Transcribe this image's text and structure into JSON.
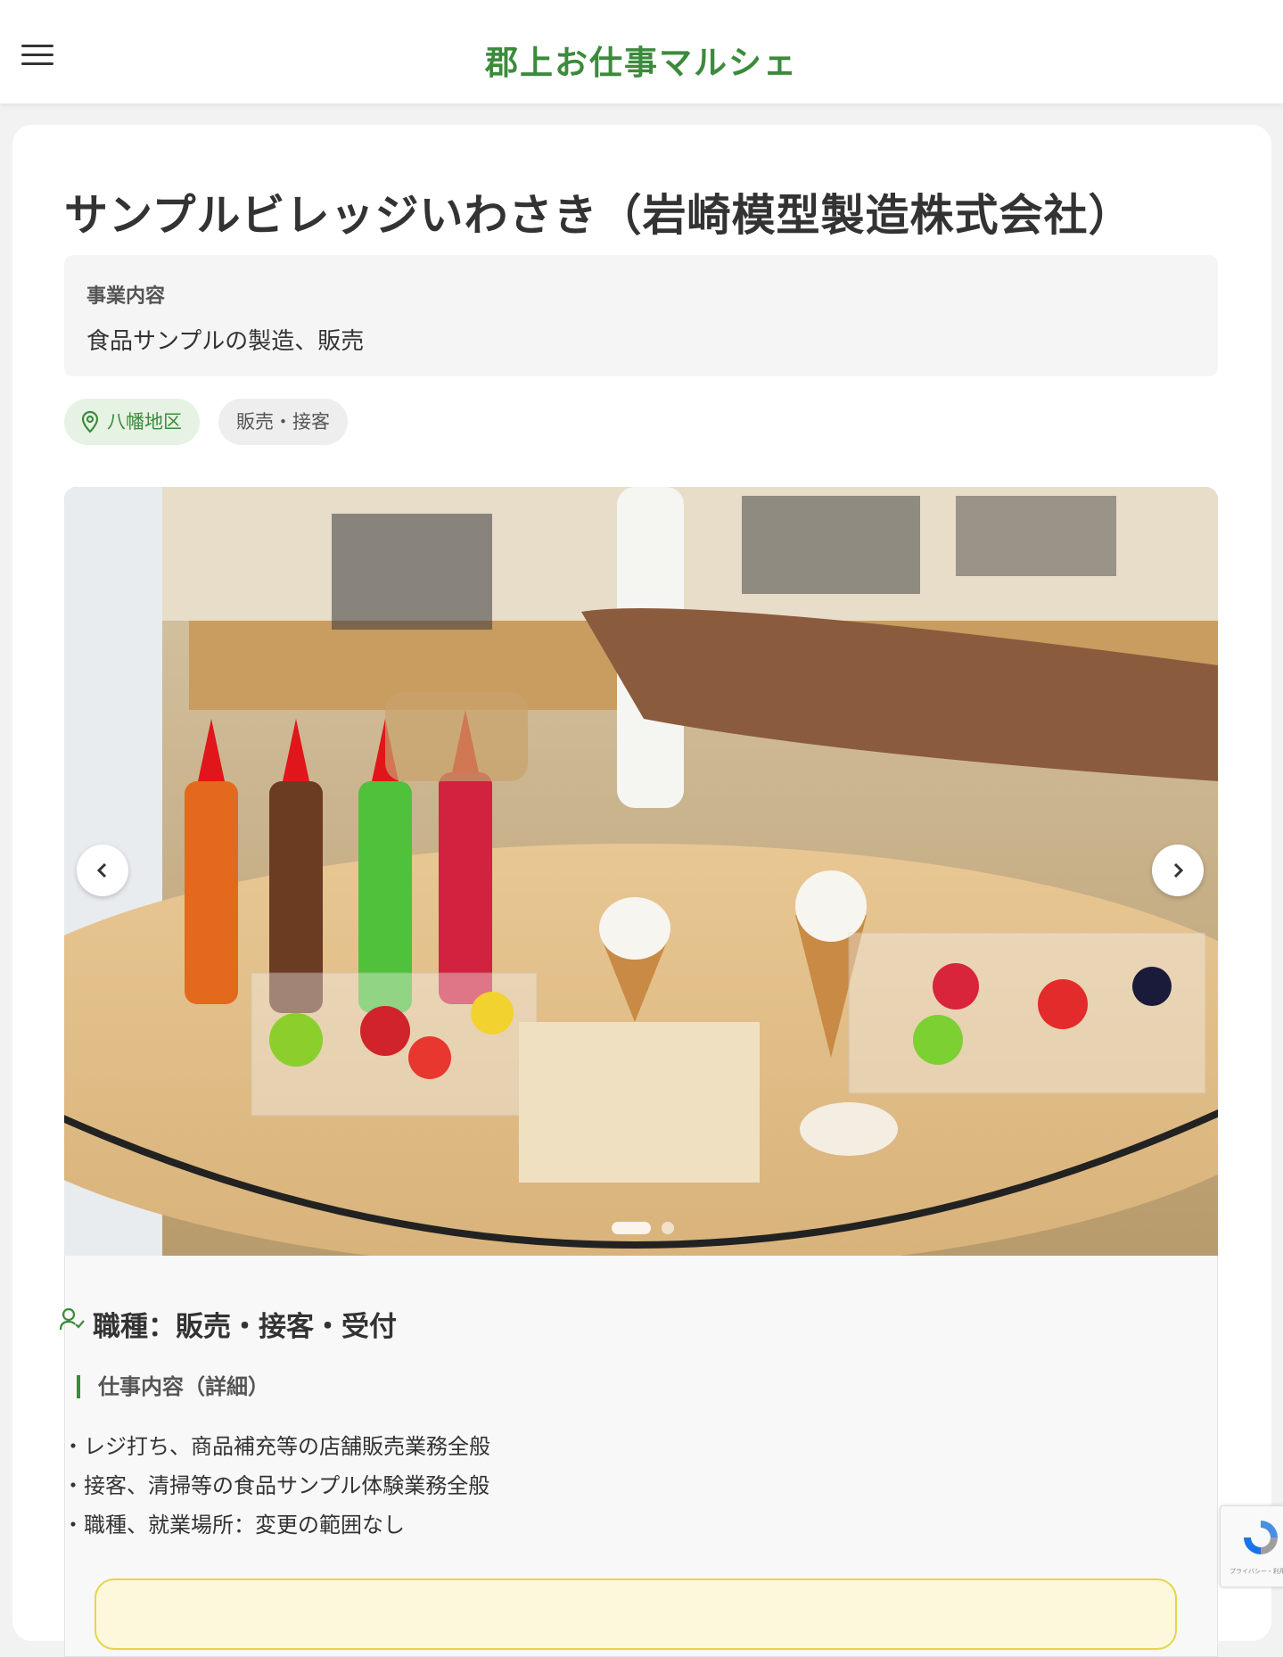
{
  "header": {
    "site_title": "郡上お仕事マルシェ",
    "menu_icon": "hamburger-menu-icon"
  },
  "company": {
    "name": "サンプルビレッジいわさき（岩崎模型製造株式会社）",
    "business_label": "事業内容",
    "business_text": "食品サンプルの製造、販売"
  },
  "tags": {
    "area": "八幡地区",
    "area_icon": "map-pin-icon",
    "job_category": "販売・接客"
  },
  "gallery": {
    "prev_icon": "chevron-left-icon",
    "next_icon": "chevron-right-icon",
    "slide_count": 2,
    "active_slide": 1
  },
  "job": {
    "icon": "person-check-icon",
    "title": "職種：販売・接客・受付",
    "detail_heading": "仕事内容（詳細）",
    "details": [
      "・レジ打ち、商品補充等の店舗販売業務全般",
      "・接客、清掃等の食品サンプル体験業務全般",
      "・職種、就業場所：変更の範囲なし"
    ]
  },
  "recaptcha": {
    "text": "プライバシー・利用規約"
  },
  "colors": {
    "accent_green": "#3c8a3c",
    "tag_area_bg": "#e6f2e3",
    "notice_border": "#e6d44a"
  }
}
